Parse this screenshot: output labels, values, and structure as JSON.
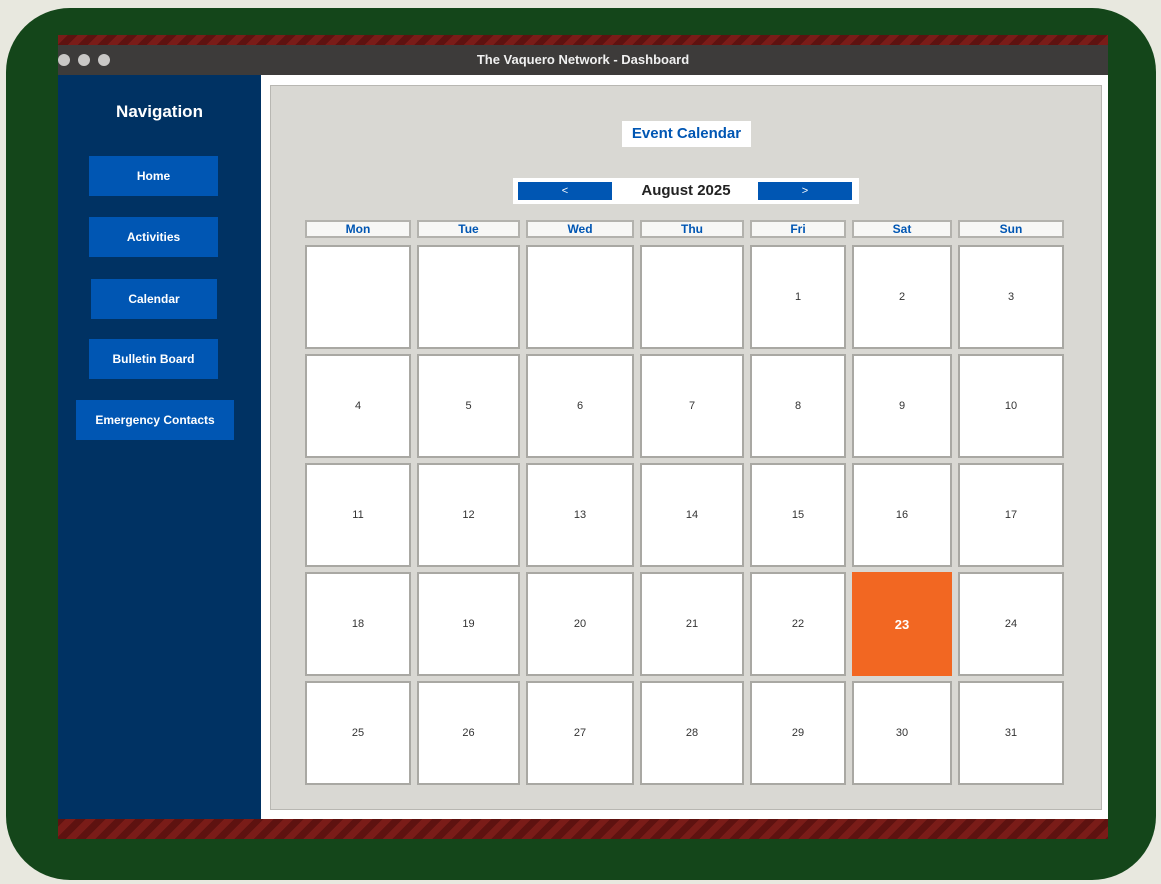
{
  "window": {
    "title": "The Vaquero Network - Dashboard"
  },
  "sidebar": {
    "title": "Navigation",
    "items": [
      {
        "label": "Home"
      },
      {
        "label": "Activities"
      },
      {
        "label": "Calendar"
      },
      {
        "label": "Bulletin Board"
      },
      {
        "label": "Emergency Contacts"
      }
    ]
  },
  "calendar": {
    "title": "Event Calendar",
    "month_label": "August 2025",
    "prev_label": "<",
    "next_label": ">",
    "weekdays": [
      "Mon",
      "Tue",
      "Wed",
      "Thu",
      "Fri",
      "Sat",
      "Sun"
    ],
    "days": [
      [
        "",
        "",
        "",
        "",
        "1",
        "2",
        "3"
      ],
      [
        "4",
        "5",
        "6",
        "7",
        "8",
        "9",
        "10"
      ],
      [
        "11",
        "12",
        "13",
        "14",
        "15",
        "16",
        "17"
      ],
      [
        "18",
        "19",
        "20",
        "21",
        "22",
        "23",
        "24"
      ],
      [
        "25",
        "26",
        "27",
        "28",
        "29",
        "30",
        "31"
      ]
    ],
    "highlighted_day": "23",
    "highlight_color": "#f26722"
  },
  "colors": {
    "accent": "#0056b3",
    "sidebar": "#003263",
    "frame": "#14461a"
  }
}
